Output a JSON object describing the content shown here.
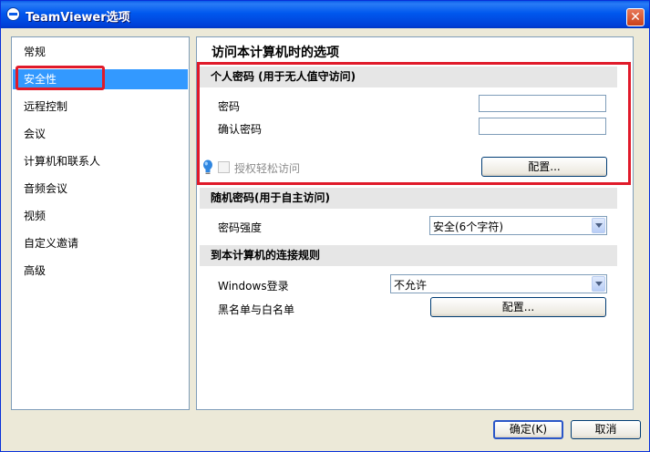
{
  "window": {
    "title": "TeamViewer选项",
    "close_symbol": "✕"
  },
  "nav": {
    "items": [
      {
        "label": "常规"
      },
      {
        "label": "安全性"
      },
      {
        "label": "远程控制"
      },
      {
        "label": "会议"
      },
      {
        "label": "计算机和联系人"
      },
      {
        "label": "音频会议"
      },
      {
        "label": "视频"
      },
      {
        "label": "自定义邀请"
      },
      {
        "label": "高级"
      }
    ],
    "selected_index": 1
  },
  "content": {
    "title": "访问本计算机时的选项",
    "personal_password": {
      "header": "个人密码 (用于无人值守访问)",
      "password_label": "密码",
      "password_value": "",
      "confirm_label": "确认密码",
      "confirm_value": "",
      "easy_access_label": "授权轻松访问",
      "easy_access_checked": false,
      "configure_label": "配置..."
    },
    "random_password": {
      "header": "随机密码(用于自主访问)",
      "strength_label": "密码强度",
      "strength_value": "安全(6个字符)"
    },
    "connection_rules": {
      "header": "到本计算机的连接规则",
      "windows_login_label": "Windows登录",
      "windows_login_value": "不允许",
      "blacklist_label": "黑名单与白名单",
      "configure_label": "配置..."
    }
  },
  "footer": {
    "ok_label": "确定(K)",
    "cancel_label": "取消"
  },
  "colors": {
    "selection": "#3399ff",
    "annotation_red": "#e01a2a",
    "titlebar": "#0058ee"
  }
}
